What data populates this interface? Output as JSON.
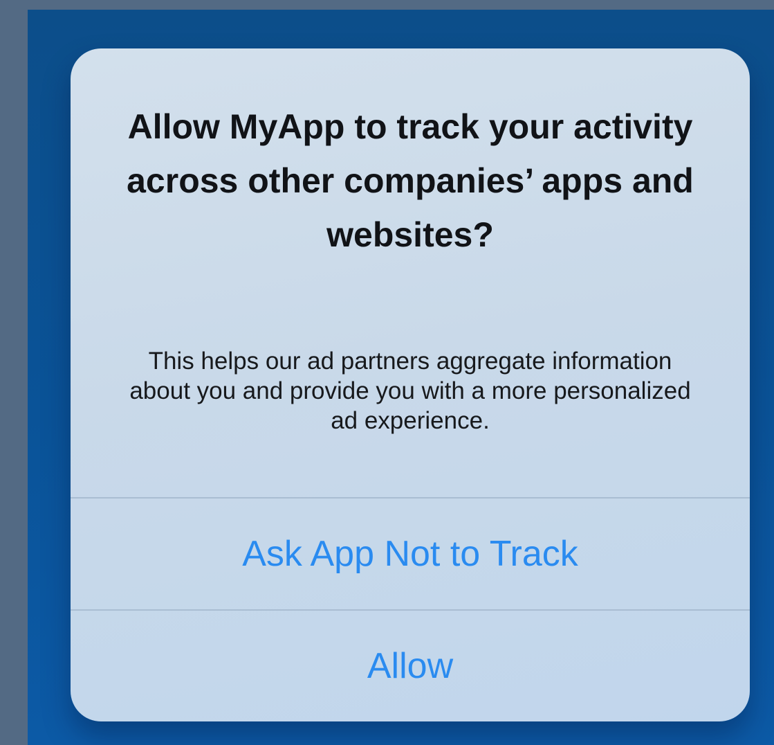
{
  "alert": {
    "title": "Allow  MyApp  to track your activity across other companies’ apps and websites?",
    "message": "This helps our ad partners aggregate information about you and provide you with a more personalized ad experience.",
    "actions": [
      {
        "label": "Ask App Not to Track"
      },
      {
        "label": "Allow"
      }
    ]
  },
  "colors": {
    "outer_background": "#536a84",
    "backdrop": "#0c5aa6",
    "alert_background": "#c9d9e9",
    "action_text": "#2a8bf0",
    "separator": "#a9bdd2"
  }
}
